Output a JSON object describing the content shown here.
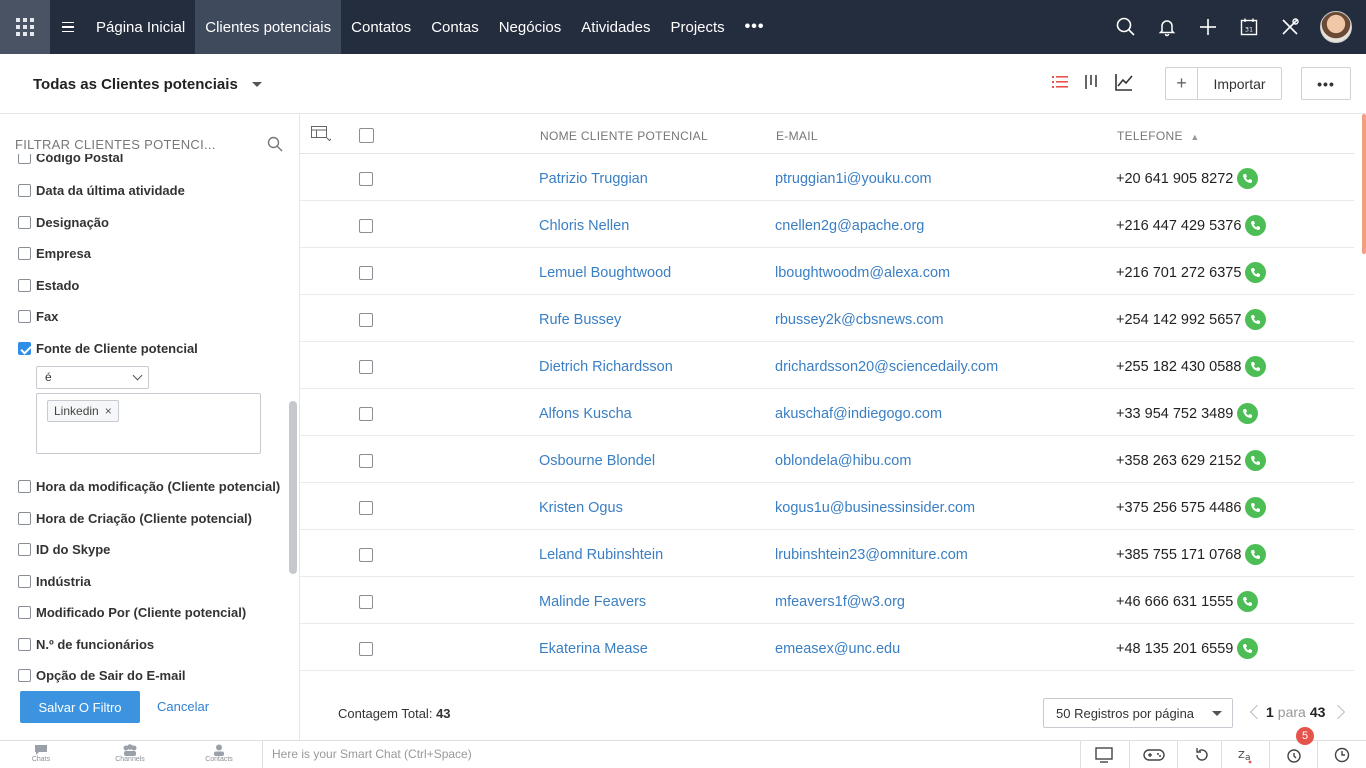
{
  "nav": {
    "tabs": [
      {
        "label": "Página Inicial"
      },
      {
        "label": "Clientes potenciais",
        "active": true
      },
      {
        "label": "Contatos"
      },
      {
        "label": "Contas"
      },
      {
        "label": "Negócios"
      },
      {
        "label": "Atividades"
      },
      {
        "label": "Projects"
      }
    ],
    "more_label": "•••",
    "calendar_day": "31",
    "icons": [
      "search-icon",
      "bell-icon",
      "plus-icon",
      "calendar-icon",
      "tools-icon"
    ]
  },
  "subheader": {
    "view_title": "Todas as Clientes potenciais",
    "import_label": "Importar",
    "more_label": "•••"
  },
  "sidebar": {
    "search_placeholder": "FILTRAR CLIENTES POTENCI...",
    "partial_item": "Código Postal",
    "items_before": [
      "Data da última atividade",
      "Designação",
      "Empresa",
      "Estado",
      "Fax"
    ],
    "checked_item": "Fonte de Cliente potencial",
    "operator": "é",
    "tag": "Linkedin",
    "items_after": [
      "Hora da modificação (Cliente potencial)",
      "Hora de Criação (Cliente potencial)",
      "ID do Skype",
      "Indústria",
      "Modificado Por (Cliente potencial)",
      "N.º de funcionários",
      "Opção de Sair do E-mail"
    ],
    "save_label": "Salvar O Filtro",
    "cancel_label": "Cancelar"
  },
  "table": {
    "headers": {
      "name": "NOME CLIENTE POTENCIAL",
      "email": "E-MAIL",
      "phone": "TELEFONE"
    },
    "rows": [
      {
        "name": "Patrizio Truggian",
        "email": "ptruggian1i@youku.com",
        "phone": "+20 641 905 8272"
      },
      {
        "name": "Chloris Nellen",
        "email": "cnellen2g@apache.org",
        "phone": "+216 447 429 5376"
      },
      {
        "name": "Lemuel Boughtwood",
        "email": "lboughtwoodm@alexa.com",
        "phone": "+216 701 272 6375"
      },
      {
        "name": "Rufe Bussey",
        "email": "rbussey2k@cbsnews.com",
        "phone": "+254 142 992 5657"
      },
      {
        "name": "Dietrich Richardsson",
        "email": "drichardsson20@sciencedaily.com",
        "phone": "+255 182 430 0588"
      },
      {
        "name": "Alfons Kuscha",
        "email": "akuschaf@indiegogo.com",
        "phone": "+33 954 752 3489"
      },
      {
        "name": "Osbourne Blondel",
        "email": "oblondela@hibu.com",
        "phone": "+358 263 629 2152"
      },
      {
        "name": "Kristen Ogus",
        "email": "kogus1u@businessinsider.com",
        "phone": "+375 256 575 4486"
      },
      {
        "name": "Leland Rubinshtein",
        "email": "lrubinshtein23@omniture.com",
        "phone": "+385 755 171 0768"
      },
      {
        "name": "Malinde Feavers",
        "email": "mfeavers1f@w3.org",
        "phone": "+46 666 631 1555"
      },
      {
        "name": "Ekaterina Mease",
        "email": "emeasex@unc.edu",
        "phone": "+48 135 201 6559"
      }
    ]
  },
  "footer": {
    "total_label": "Contagem Total:",
    "total_value": "43",
    "per_page": "50 Registros por página",
    "page_current": "1",
    "page_sep": "para",
    "page_total": "43"
  },
  "bottombar": {
    "chats": "Chats",
    "channels": "Channels",
    "contacts": "Contacts",
    "smartchat_placeholder": "Here is your Smart Chat (Ctrl+Space)",
    "notification_count": "5"
  }
}
